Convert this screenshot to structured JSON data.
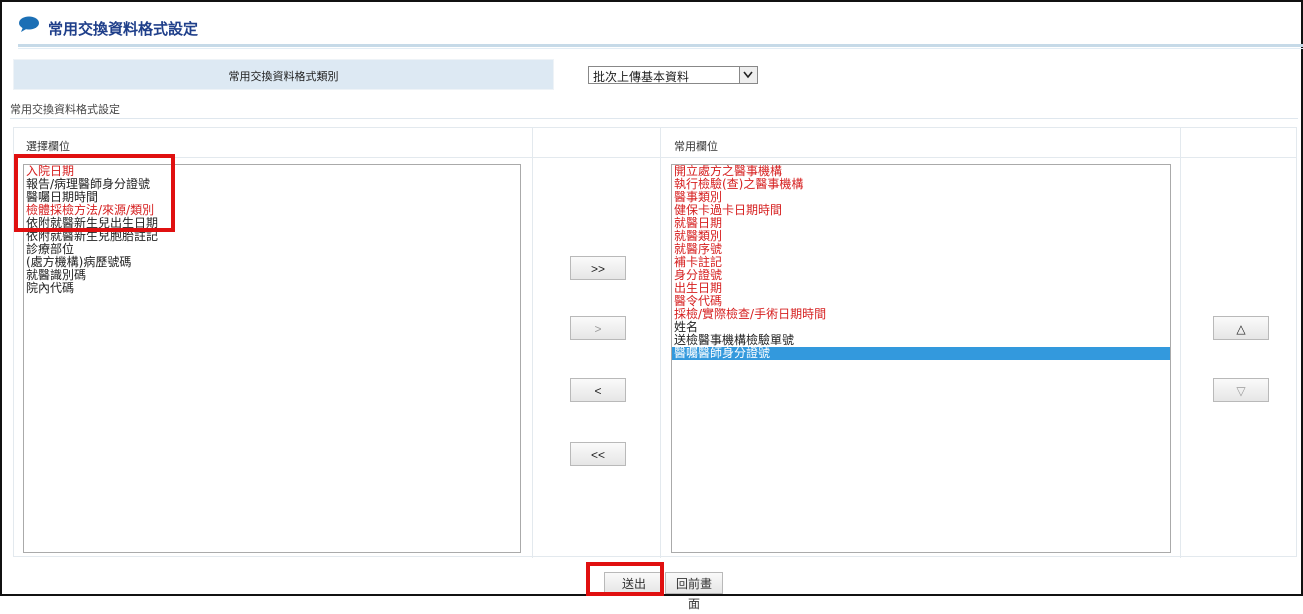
{
  "page": {
    "title": "常用交換資料格式設定"
  },
  "category": {
    "label": "常用交換資料格式類別",
    "selected": "批次上傳基本資料"
  },
  "section": {
    "caption": "常用交換資料格式設定"
  },
  "available": {
    "header": "選擇欄位",
    "items": [
      {
        "text": "入院日期",
        "red": true
      },
      {
        "text": "報告/病理醫師身分證號",
        "red": false
      },
      {
        "text": "醫囑日期時間",
        "red": false
      },
      {
        "text": "檢體採檢方法/來源/類別",
        "red": true
      },
      {
        "text": "依附就醫新生兒出生日期",
        "red": false
      },
      {
        "text": "依附就醫新生兒胞胎註記",
        "red": false
      },
      {
        "text": "診療部位",
        "red": false
      },
      {
        "text": "(處方機構)病歷號碼",
        "red": false
      },
      {
        "text": "就醫識別碼",
        "red": false
      },
      {
        "text": "院內代碼",
        "red": false
      }
    ]
  },
  "transfer": {
    "add_all": ">>",
    "add": ">",
    "remove": "<",
    "remove_all": "<<"
  },
  "selected": {
    "header": "常用欄位",
    "items": [
      {
        "text": "開立處方之醫事機構",
        "red": true,
        "sel": false
      },
      {
        "text": "執行檢驗(查)之醫事機構",
        "red": true,
        "sel": false
      },
      {
        "text": "醫事類別",
        "red": true,
        "sel": false
      },
      {
        "text": "健保卡過卡日期時間",
        "red": true,
        "sel": false
      },
      {
        "text": "就醫日期",
        "red": true,
        "sel": false
      },
      {
        "text": "就醫類別",
        "red": true,
        "sel": false
      },
      {
        "text": "就醫序號",
        "red": true,
        "sel": false
      },
      {
        "text": "補卡註記",
        "red": true,
        "sel": false
      },
      {
        "text": "身分證號",
        "red": true,
        "sel": false
      },
      {
        "text": "出生日期",
        "red": true,
        "sel": false
      },
      {
        "text": "醫令代碼",
        "red": true,
        "sel": false
      },
      {
        "text": "採檢/實際檢查/手術日期時間",
        "red": true,
        "sel": false
      },
      {
        "text": "姓名",
        "red": false,
        "sel": false
      },
      {
        "text": "送檢醫事機構檢驗單號",
        "red": false,
        "sel": false
      },
      {
        "text": "醫囑醫師身分證號",
        "red": false,
        "sel": true
      }
    ]
  },
  "order": {
    "up": "△",
    "down": "▽"
  },
  "actions": {
    "submit": "送出",
    "back": "回前畫面"
  },
  "colors": {
    "required": "#d62020",
    "selection": "#3399dd",
    "highlight": "#e01010",
    "header_bg": "#dde9f3"
  }
}
